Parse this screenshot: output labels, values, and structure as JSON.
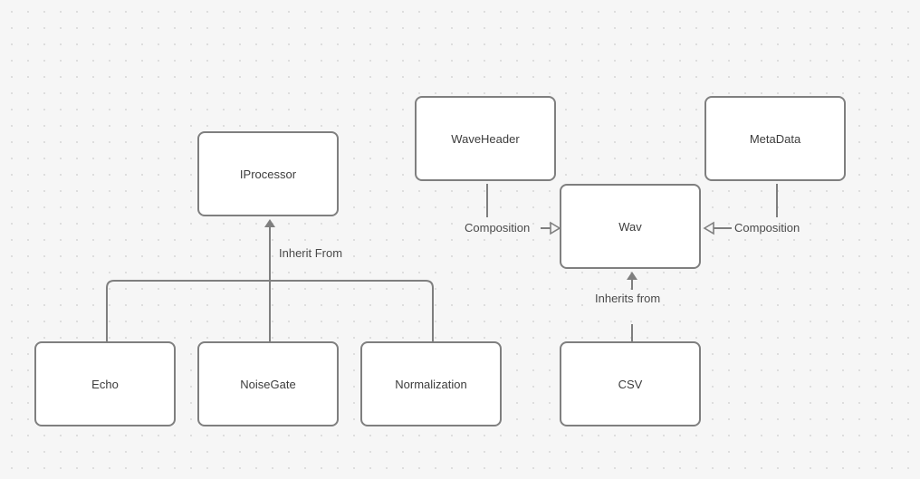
{
  "nodes": {
    "iprocessor": "IProcessor",
    "echo": "Echo",
    "noisegate": "NoiseGate",
    "normalization": "Normalization",
    "waveheader": "WaveHeader",
    "metadata": "MetaData",
    "wav": "Wav",
    "csv": "CSV"
  },
  "edges": {
    "inherit_from": "Inherit From",
    "composition_left": "Composition",
    "composition_right": "Composition",
    "inherits_from": "Inherits from"
  },
  "colors": {
    "line": "#7f7f7f",
    "node_border": "#7f7f7f",
    "background": "#f6f6f6"
  }
}
